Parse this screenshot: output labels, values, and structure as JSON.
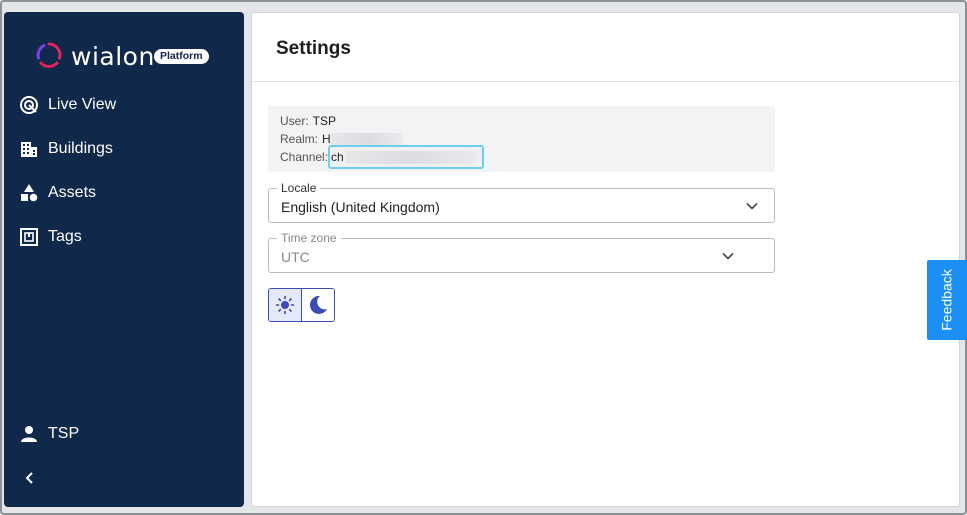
{
  "brand": {
    "name": "wialon",
    "badge": "Platform"
  },
  "sidebar": {
    "items": [
      {
        "label": "Live View",
        "icon": "live-view-icon"
      },
      {
        "label": "Buildings",
        "icon": "buildings-icon"
      },
      {
        "label": "Assets",
        "icon": "assets-icon"
      },
      {
        "label": "Tags",
        "icon": "tags-icon"
      }
    ],
    "user": {
      "label": "TSP",
      "icon": "user-icon"
    },
    "collapse_icon": "chevron-left-icon"
  },
  "page": {
    "title": "Settings"
  },
  "info": {
    "user_key": "User:",
    "user_value": "TSP",
    "realm_key": "Realm:",
    "realm_value": "H",
    "channel_key": "Channel:",
    "channel_value": "ch"
  },
  "locale": {
    "label": "Locale",
    "value": "English (United Kingdom)"
  },
  "timezone": {
    "label": "Time zone",
    "value": "UTC"
  },
  "theme": {
    "light_icon": "sun-icon",
    "dark_icon": "moon-icon",
    "selected": "light"
  },
  "feedback": {
    "label": "Feedback"
  },
  "colors": {
    "sidebar_bg": "#10284a",
    "accent": "#3d4bb6",
    "feedback": "#1c8ff5",
    "focus": "#6dcff0"
  }
}
